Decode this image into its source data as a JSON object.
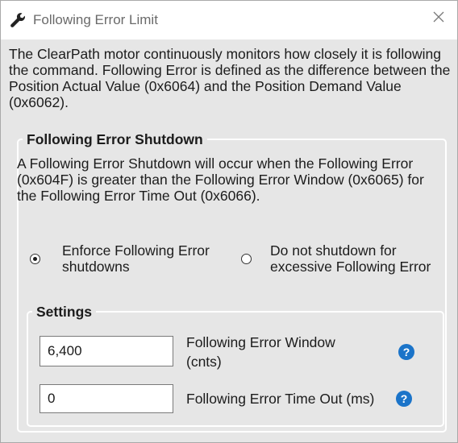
{
  "window": {
    "title": "Following Error Limit",
    "title_icon": "wrench-icon",
    "close_icon": "close-icon"
  },
  "intro": "The ClearPath motor continuously monitors how closely it is following the command. Following Error is defined as the difference between the Position Actual Value (0x6064) and the Position Demand Value (0x6062).",
  "shutdown": {
    "legend": "Following Error Shutdown",
    "description": "A Following Error Shutdown will occur when the Following Error (0x604F) is greater than the Following Error Window (0x6065) for the Following Error Time Out (0x6066).",
    "options": [
      {
        "line1": "Enforce Following Error",
        "line2": "shutdowns",
        "selected": true
      },
      {
        "line1": "Do not shutdown for",
        "line2": "excessive Following Error",
        "selected": false
      }
    ]
  },
  "settings": {
    "legend": "Settings",
    "fields": [
      {
        "value": "6,400",
        "label_line1": "Following Error Window",
        "label_line2": "(cnts)",
        "help": "?"
      },
      {
        "value": "0",
        "label_line1": "Following Error Time Out (ms)",
        "label_line2": "",
        "help": "?"
      }
    ]
  },
  "colors": {
    "help_icon": "#1b74c9",
    "background": "#e6e6e6"
  }
}
